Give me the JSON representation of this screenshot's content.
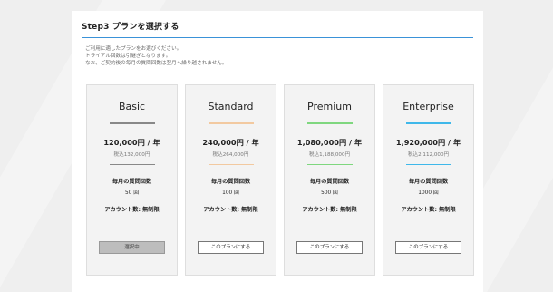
{
  "step_title": "Step3 プランを選択する",
  "notes": [
    "ご利用に適したプランをお選びください。",
    "トライアル回数は引継ぎとなります。",
    "なお、ご契約後の毎月の質問回数は翌月へ繰り越されません。"
  ],
  "labels": {
    "monthly_questions": "毎月の質問回数",
    "account_count": "アカウント数: 無制限"
  },
  "plans": [
    {
      "name": "Basic",
      "accent_color": "#888888",
      "price": "120,000円 / 年",
      "price_tax": "税込132,000円",
      "questions": "50 回",
      "button_label": "選択中",
      "selected": true
    },
    {
      "name": "Standard",
      "accent_color": "#f2c9a0",
      "price": "240,000円 / 年",
      "price_tax": "税込264,000円",
      "questions": "100 回",
      "button_label": "このプランにする",
      "selected": false
    },
    {
      "name": "Premium",
      "accent_color": "#7fd77f",
      "price": "1,080,000円 / 年",
      "price_tax": "税込1,188,000円",
      "questions": "500 回",
      "button_label": "このプランにする",
      "selected": false
    },
    {
      "name": "Enterprise",
      "accent_color": "#3fb8ea",
      "price": "1,920,000円 / 年",
      "price_tax": "税込2,112,000円",
      "questions": "1000 回",
      "button_label": "このプランにする",
      "selected": false
    }
  ]
}
